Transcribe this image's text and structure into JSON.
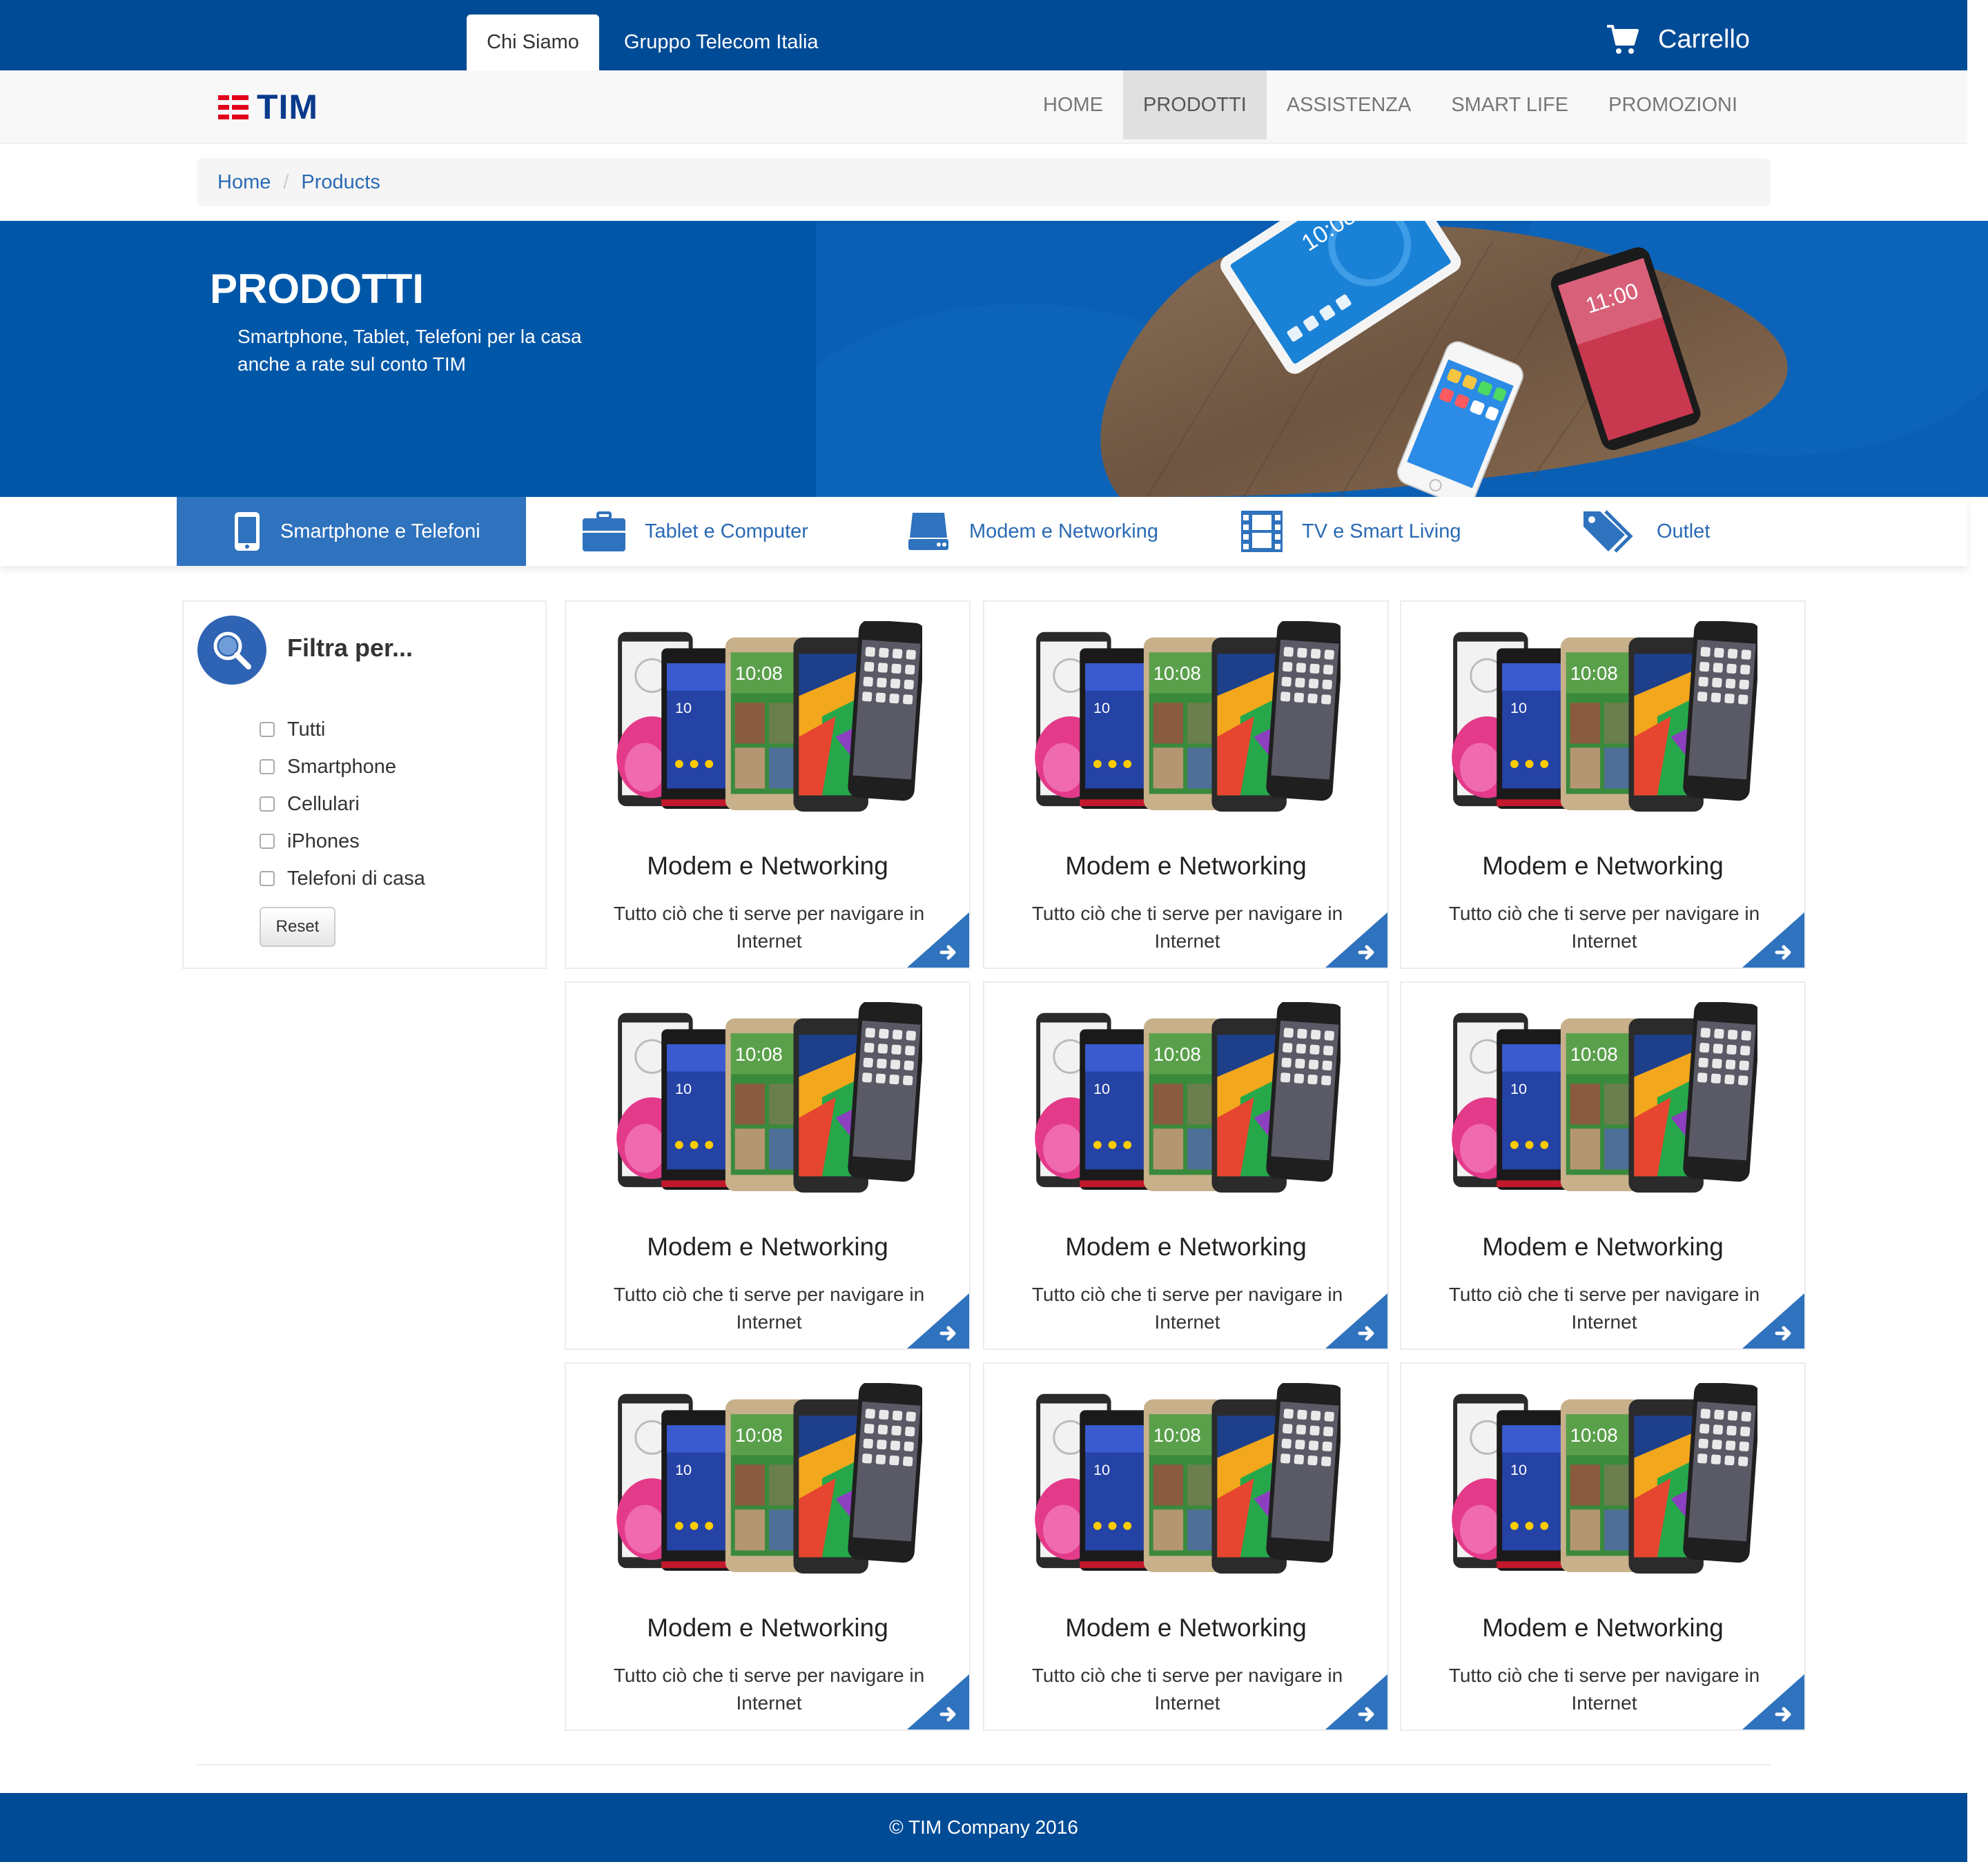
{
  "topbar": {
    "tabs": [
      {
        "label": "Chi Siamo",
        "active": true
      },
      {
        "label": "Gruppo Telecom Italia",
        "active": false
      }
    ],
    "cart_label": "Carrello"
  },
  "logo": {
    "text": "TIM"
  },
  "nav": {
    "items": [
      {
        "label": "HOME",
        "active": false
      },
      {
        "label": "PRODOTTI",
        "active": true
      },
      {
        "label": "ASSISTENZA",
        "active": false
      },
      {
        "label": "SMART LIFE",
        "active": false
      },
      {
        "label": "PROMOZIONI",
        "active": false
      }
    ]
  },
  "breadcrumb": {
    "items": [
      "Home",
      "Products"
    ],
    "separator": "/"
  },
  "hero": {
    "title": "PRODOTTI",
    "subtitle_line1": "Smartphone, Tablet, Telefoni per la casa",
    "subtitle_line2": "anche a rate sul conto TIM"
  },
  "categories": [
    {
      "label": "Smartphone e Telefoni",
      "icon": "smartphone-icon",
      "active": true
    },
    {
      "label": "Tablet e Computer",
      "icon": "briefcase-icon",
      "active": false
    },
    {
      "label": "Modem e Networking",
      "icon": "modem-icon",
      "active": false
    },
    {
      "label": "TV e Smart Living",
      "icon": "film-icon",
      "active": false
    },
    {
      "label": "Outlet",
      "icon": "tag-icon",
      "active": false
    }
  ],
  "filter": {
    "title": "Filtra per...",
    "options": [
      "Tutti",
      "Smartphone",
      "Cellulari",
      "iPhones",
      "Telefoni di casa"
    ],
    "reset_label": "Reset"
  },
  "products": [
    {
      "title": "Modem e Networking",
      "desc": "Tutto ciò che ti serve per navigare in Internet"
    },
    {
      "title": "Modem e Networking",
      "desc": "Tutto ciò che ti serve per navigare in Internet"
    },
    {
      "title": "Modem e Networking",
      "desc": "Tutto ciò che ti serve per navigare in Internet"
    },
    {
      "title": "Modem e Networking",
      "desc": "Tutto ciò che ti serve per navigare in Internet"
    },
    {
      "title": "Modem e Networking",
      "desc": "Tutto ciò che ti serve per navigare in Internet"
    },
    {
      "title": "Modem e Networking",
      "desc": "Tutto ciò che ti serve per navigare in Internet"
    },
    {
      "title": "Modem e Networking",
      "desc": "Tutto ciò che ti serve per navigare in Internet"
    },
    {
      "title": "Modem e Networking",
      "desc": "Tutto ciò che ti serve per navigare in Internet"
    },
    {
      "title": "Modem e Networking",
      "desc": "Tutto ciò che ti serve per navigare in Internet"
    }
  ],
  "footer": {
    "text": "© TIM Company 2016"
  },
  "colors": {
    "brand_dark": "#004b96",
    "hero_blue": "#0057a8",
    "accent": "#2f72bd",
    "logo_red": "#e2001a"
  }
}
